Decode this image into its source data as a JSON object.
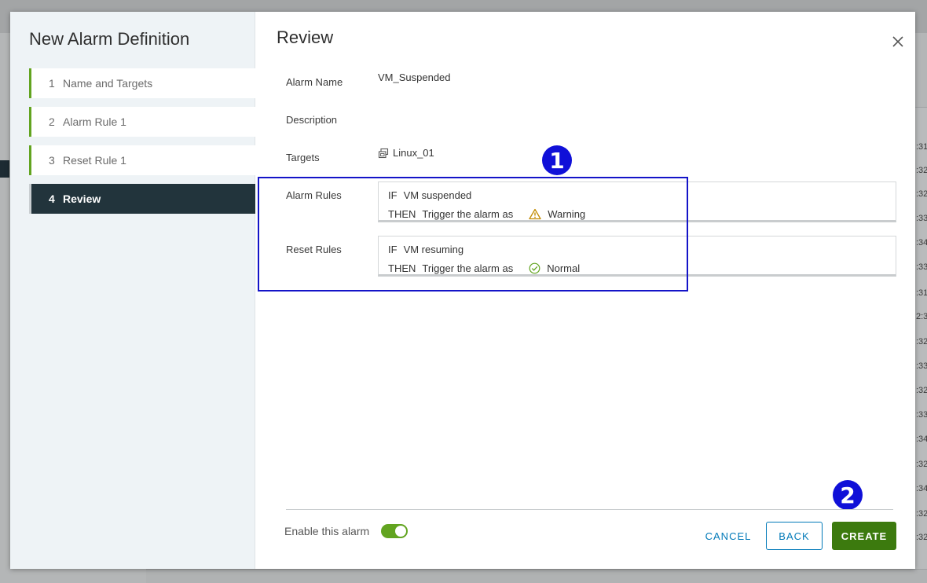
{
  "background": {
    "table_cells": [
      ":31",
      ":32",
      ":32",
      ":33",
      ":34",
      ":33",
      ":31",
      "2:3",
      ":32",
      ":33",
      ":32",
      ":33",
      ":34",
      ":32",
      ":34",
      ":32",
      ":32"
    ]
  },
  "wizard": {
    "title": "New Alarm Definition",
    "steps": [
      {
        "num": "1",
        "label": "Name and Targets"
      },
      {
        "num": "2",
        "label": "Alarm Rule 1"
      },
      {
        "num": "3",
        "label": "Reset Rule 1"
      },
      {
        "num": "4",
        "label": "Review"
      }
    ]
  },
  "review": {
    "title": "Review",
    "alarm_name_label": "Alarm Name",
    "alarm_name_value": "VM_Suspended",
    "description_label": "Description",
    "targets_label": "Targets",
    "targets_value": "Linux_01",
    "alarm_rules_label": "Alarm Rules",
    "alarm_rule": {
      "if_kw": "IF",
      "condition": "VM suspended",
      "then_kw": "THEN",
      "action": "Trigger the alarm as",
      "status": "Warning"
    },
    "reset_rules_label": "Reset Rules",
    "reset_rule": {
      "if_kw": "IF",
      "condition": "VM resuming",
      "then_kw": "THEN",
      "action": "Trigger the alarm as",
      "status": "Normal"
    }
  },
  "annotations": {
    "badge_1": "1",
    "badge_2": "2"
  },
  "footer": {
    "enable_label": "Enable this alarm",
    "enabled": true,
    "cancel": "CANCEL",
    "back": "BACK",
    "create": "CREATE"
  },
  "colors": {
    "accent_green": "#62a420",
    "create_button": "#3c7a0e",
    "link_blue": "#0079b8",
    "active_step": "#22343c",
    "annotation_blue": "#1010d8",
    "warning": "#c28b00",
    "normal": "#62a420"
  },
  "icons": {
    "close": "close-icon",
    "target": "vm-icon",
    "warning": "warning-icon",
    "normal": "check-circle-icon"
  }
}
